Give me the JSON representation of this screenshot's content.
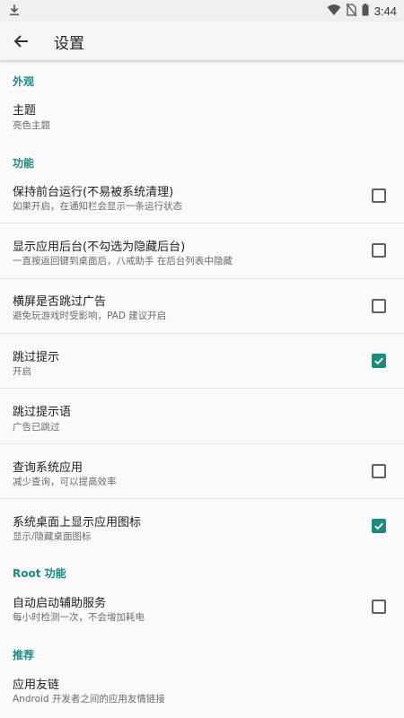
{
  "status_bar": {
    "time": "3:44"
  },
  "app_bar": {
    "title": "设置"
  },
  "sections": {
    "appearance": "外观",
    "features": "功能",
    "root": "Root 功能",
    "recommend": "推荐"
  },
  "items": {
    "theme": {
      "title": "主题",
      "summary": "亮色主题"
    },
    "keep_foreground": {
      "title": "保持前台运行(不易被系统清理)",
      "summary": "如果开启，在通知栏会显示一条运行状态",
      "checked": false
    },
    "show_background": {
      "title": "显示应用后台(不勾选为隐藏后台)",
      "summary": "一直按返回键到桌面后，八戒助手 在后台列表中隐藏",
      "checked": false
    },
    "landscape_skip": {
      "title": "横屏是否跳过广告",
      "summary": "避免玩游戏时受影响，PAD 建议开启",
      "checked": false
    },
    "skip_tip": {
      "title": "跳过提示",
      "summary": "开启",
      "checked": true
    },
    "skip_tip_text": {
      "title": "跳过提示语",
      "summary": "广告已跳过"
    },
    "query_system_apps": {
      "title": "查询系统应用",
      "summary": "减少查询，可以提高效率",
      "checked": false
    },
    "show_launcher_icon": {
      "title": "系统桌面上显示应用图标",
      "summary": "显示/隐藏桌面图标",
      "checked": true
    },
    "auto_start_accessibility": {
      "title": "自动启动辅助服务",
      "summary": "每小时检测一次，不会增加耗电",
      "checked": false
    },
    "friend_links": {
      "title": "应用友链",
      "summary": "Android 开发者之间的应用友情链接"
    }
  },
  "colors": {
    "accent": "#1e8a7e",
    "text_primary": "#212121",
    "text_secondary": "#6b6b6b"
  }
}
